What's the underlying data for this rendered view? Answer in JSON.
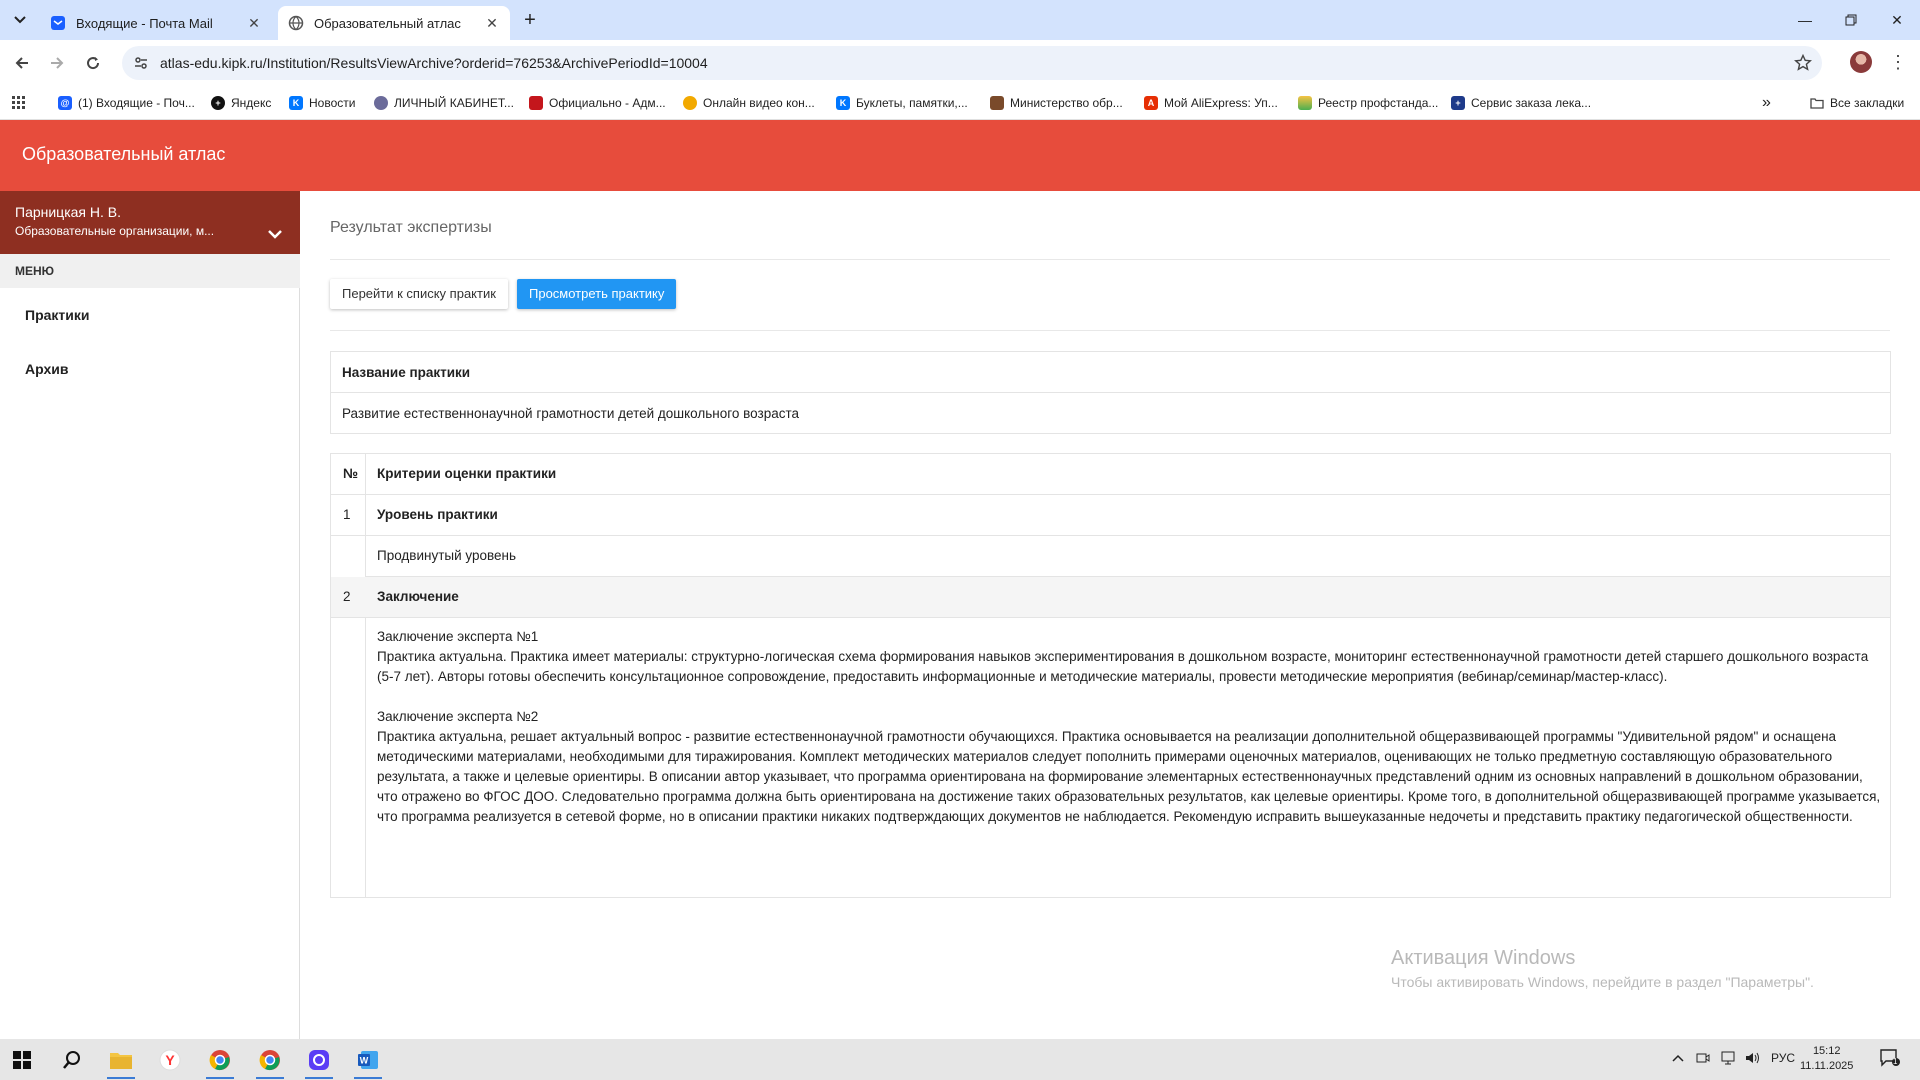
{
  "browser": {
    "tabs": [
      {
        "title": "Входящие - Почта Mail",
        "icon": "mail-icon"
      },
      {
        "title": "Образовательный атлас",
        "icon": "globe-icon"
      }
    ],
    "url": "atlas-edu.kipk.ru/Institution/ResultsViewArchive?orderid=76253&ArchivePeriodId=10004",
    "bookmarks": [
      "(1) Входящие - Поч...",
      "Яндекс",
      "Новости",
      "ЛИЧНЫЙ КАБИНЕТ...",
      "Официально - Адм...",
      "Онлайн видео кон...",
      "Буклеты, памятки,...",
      "Министерство обр...",
      "Мой AliExpress: Уп...",
      "Реестр профстанда...",
      "Сервис заказа лека..."
    ],
    "all_bookmarks": "Все закладки",
    "more": "»"
  },
  "app": {
    "title": "Образовательный атлас",
    "accent": "#e74c3c"
  },
  "sidebar": {
    "user_name": "Парницкая Н. В.",
    "user_org": "Образовательные организации, м...",
    "menu_label": "МЕНЮ",
    "items": [
      "Практики",
      "Архив"
    ]
  },
  "main": {
    "page_title": "Результат экспертизы",
    "btn_list": "Перейти к списку практик",
    "btn_view": "Просмотреть практику",
    "practice_header": "Название практики",
    "practice_name": "Развитие естественнонаучной грамотности детей дошкольного возраста",
    "table": {
      "col_num": "№",
      "col_criteria": "Критерии оценки практики",
      "rows": [
        {
          "num": "1",
          "title": "Уровень практики",
          "value": "Продвинутый уровень"
        },
        {
          "num": "2",
          "title": "Заключение"
        }
      ],
      "expert1_title": "Заключение эксперта №1",
      "expert1_text": "Практика актуальна. Практика имеет материалы: структурно-логическая схема формирования навыков экспериментирования в дошкольном возрасте, мониторинг естественнонаучной грамотности детей старшего дошкольного возраста (5-7 лет). Авторы готовы обеспечить консультационное сопровождение, предоставить информационные и методические материалы, провести методические мероприятия (вебинар/семинар/мастер-класс).",
      "expert2_title": "Заключение эксперта №2",
      "expert2_text": "Практика актуальна, решает актуальный вопрос - развитие естественнонаучной грамотности обучающихся. Практика основывается на реализации дополнительной общеразвивающей программы \"Удивительной рядом\" и оснащена методическими материалами, необходимыми для тиражирования. Комплект методических материалов следует пополнить примерами оценочных материалов, оценивающих не только предметную составляющую образовательного результата, а также и целевые ориентиры. В описании автор указывает, что программа ориентирована на формирование элементарных естественнонаучных представлений одним из основных направлений в дошкольном образовании, что отражено во ФГОС ДОО. Следовательно программа должна быть ориентирована на достижение таких образовательных результатов, как целевые ориентиры. Кроме того, в дополнительной общеразвивающей программе указывается, что программа реализуется в сетевой форме, но в описании практики никаких подтверждающих документов не наблюдается. Рекомендую исправить вышеуказанные недочеты и представить практику педагогической общественности."
    }
  },
  "watermark": {
    "line1": "Активация Windows",
    "line2": "Чтобы активировать Windows, перейдите в раздел \"Параметры\"."
  },
  "taskbar": {
    "lang": "РУС",
    "time": "15:12",
    "date": "11.11.2025",
    "notif_count": "1"
  }
}
